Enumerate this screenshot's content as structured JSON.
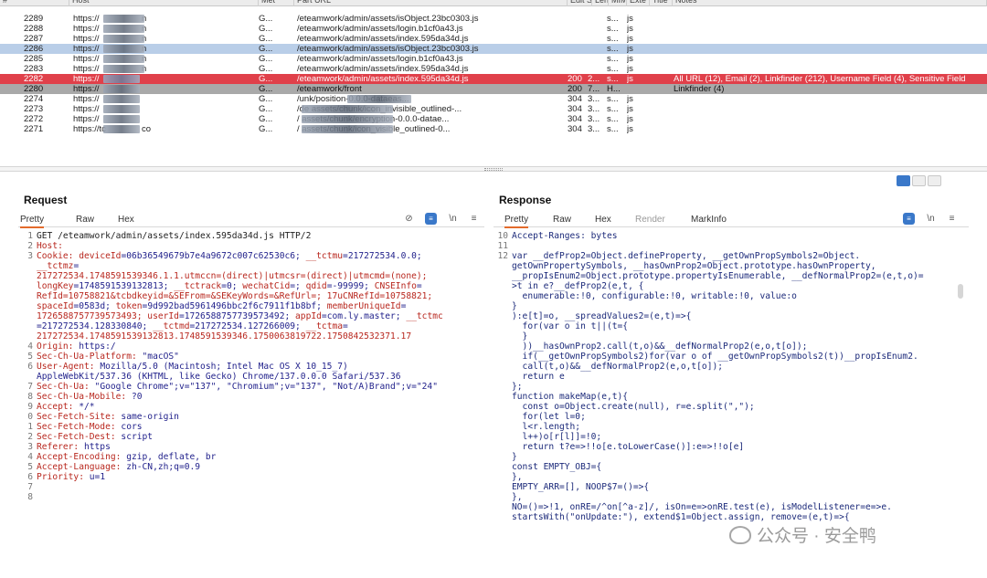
{
  "history": {
    "columns": [
      "#",
      "Host",
      "Met",
      "Part URL",
      "Edit Stat",
      "Len",
      "MIM",
      "Exte",
      "Title",
      "Notes"
    ],
    "rows": [
      {
        "num": "2289",
        "host": "https://",
        "hostend": "n",
        "method": "G...",
        "url": "/eteamwork/admin/assets/isObject.23bc0303.js",
        "status": "",
        "len": "",
        "mime": "s...",
        "ext": "js",
        "notes": "",
        "style": "normal"
      },
      {
        "num": "2288",
        "host": "https://",
        "hostend": "n",
        "method": "G...",
        "url": "/eteamwork/admin/assets/login.b1cf0a43.js",
        "status": "",
        "len": "",
        "mime": "s...",
        "ext": "js",
        "notes": "",
        "style": "normal"
      },
      {
        "num": "2287",
        "host": "https://",
        "hostend": "n",
        "method": "G...",
        "url": "/eteamwork/admin/assets/index.595da34d.js",
        "status": "",
        "len": "",
        "mime": "s...",
        "ext": "js",
        "notes": "",
        "style": "normal"
      },
      {
        "num": "2286",
        "host": "https://",
        "hostend": "n",
        "method": "G...",
        "url": "/eteamwork/admin/assets/isObject.23bc0303.js",
        "status": "",
        "len": "",
        "mime": "s...",
        "ext": "js",
        "notes": "",
        "style": "sel"
      },
      {
        "num": "2285",
        "host": "https://",
        "hostend": "n",
        "method": "G...",
        "url": "/eteamwork/admin/assets/login.b1cf0a43.js",
        "status": "",
        "len": "",
        "mime": "s...",
        "ext": "js",
        "notes": "",
        "style": "normal"
      },
      {
        "num": "2283",
        "host": "https://",
        "hostend": "n",
        "method": "G...",
        "url": "/eteamwork/admin/assets/index.595da34d.js",
        "status": "",
        "len": "",
        "mime": "s...",
        "ext": "js",
        "notes": "",
        "style": "normal"
      },
      {
        "num": "2282",
        "host": "https://",
        "hostend": "",
        "method": "G...",
        "url": "/eteamwork/admin/assets/index.595da34d.js",
        "status": "200",
        "len": "2...",
        "mime": "s...",
        "ext": "js",
        "notes": "All URL (12), Email (2), Linkfinder (212), Username Field (4), Sensitive Field",
        "style": "red"
      },
      {
        "num": "2280",
        "host": "https://",
        "hostend": "",
        "method": "G...",
        "url": "/eteamwork/front",
        "status": "200",
        "len": "7...",
        "mime": "H...",
        "ext": "",
        "notes": "Linkfinder (4)",
        "style": "grey"
      },
      {
        "num": "2274",
        "host": "https://",
        "hostend": "",
        "method": "G...",
        "url": "/unk/position-0.0.0-dataeas...",
        "status": "304",
        "len": "3...",
        "mime": "s...",
        "ext": "js",
        "notes": "",
        "style": "normal"
      },
      {
        "num": "2273",
        "host": "https://",
        "hostend": "",
        "method": "G...",
        "url": "/de                 assets/chunk/icon_invisible_outlined-...",
        "status": "304",
        "len": "3...",
        "mime": "s...",
        "ext": "js",
        "notes": "",
        "style": "normal"
      },
      {
        "num": "2272",
        "host": "https://",
        "hostend": "",
        "method": "G...",
        "url": "/               assets/chunk/encryption-0.0.0-datae...",
        "status": "304",
        "len": "3...",
        "mime": "s...",
        "ext": "js",
        "notes": "",
        "style": "normal"
      },
      {
        "num": "2271",
        "host": "https://tc",
        "hostend": "co",
        "method": "G...",
        "url": "/               assets/chunk/icon_visible_outlined-0...",
        "status": "304",
        "len": "3...",
        "mime": "s...",
        "ext": "js",
        "notes": "",
        "style": "normal"
      }
    ]
  },
  "request": {
    "title": "Request",
    "tabs": [
      "Pretty",
      "Raw",
      "Hex"
    ],
    "lines": [
      [
        {
          "t": "GET /eteamwork/admin/assets/index.595da34d.js HTTP/2",
          "c": ""
        }
      ],
      [
        {
          "t": "Host: ",
          "c": "k"
        }
      ],
      [
        {
          "t": "Cookie: ",
          "c": "k"
        },
        {
          "t": "deviceId",
          "c": "k"
        },
        {
          "t": "=06b36549679b7e4a9672c007c62530c6; ",
          "c": "v"
        },
        {
          "t": "__tctmu",
          "c": "k"
        },
        {
          "t": "=217272534.0.0;",
          "c": "v"
        }
      ],
      [
        {
          "t": "__tctmz",
          "c": "k"
        },
        {
          "t": "=",
          "c": "v"
        }
      ],
      [
        {
          "t": "217272534.1748591539346.1.1.utmccn=(direct)|utmcsr=(direct)|utmcmd=(none);",
          "c": "r"
        }
      ],
      [
        {
          "t": "longKey",
          "c": "k"
        },
        {
          "t": "=1748591539132813; ",
          "c": "v"
        },
        {
          "t": "__tctrack",
          "c": "k"
        },
        {
          "t": "=0; ",
          "c": "v"
        },
        {
          "t": "wechatCid",
          "c": "k"
        },
        {
          "t": "=; ",
          "c": "v"
        },
        {
          "t": "qdid",
          "c": "k"
        },
        {
          "t": "=-99999; ",
          "c": "v"
        },
        {
          "t": "CNSEInfo",
          "c": "k"
        },
        {
          "t": "=",
          "c": "v"
        }
      ],
      [
        {
          "t": "RefId=10758821&tcbdkeyid=&SEFrom=&SEKeyWords=&RefUrl=; 17uCNRefId=10758821;",
          "c": "r"
        }
      ],
      [
        {
          "t": "spaceId",
          "c": "k"
        },
        {
          "t": "=0583d; ",
          "c": "v"
        },
        {
          "t": "token",
          "c": "k"
        },
        {
          "t": "=9d992bad5961496bbc2f6c7911f1b8bf; ",
          "c": "v"
        },
        {
          "t": "memberUniqueId",
          "c": "k"
        },
        {
          "t": "=",
          "c": "v"
        }
      ],
      [
        {
          "t": "1726588757739573493; ",
          "c": "r"
        },
        {
          "t": "userId",
          "c": "k"
        },
        {
          "t": "=1726588757739573492; ",
          "c": "v"
        },
        {
          "t": "appId",
          "c": "k"
        },
        {
          "t": "=com.ly.master; ",
          "c": "v"
        },
        {
          "t": "__tctmc",
          "c": "k"
        }
      ],
      [
        {
          "t": "=217272534.128330840; ",
          "c": "v"
        },
        {
          "t": "__tctmd",
          "c": "k"
        },
        {
          "t": "=217272534.127266009; ",
          "c": "v"
        },
        {
          "t": "__tctma",
          "c": "k"
        },
        {
          "t": "=",
          "c": "v"
        }
      ],
      [
        {
          "t": "217272534.1748591539132813.1748591539346.1750063819722.1750842532371.17",
          "c": "r"
        }
      ],
      [
        {
          "t": "Origin: ",
          "c": "k"
        },
        {
          "t": "https:/",
          "c": "v"
        }
      ],
      [
        {
          "t": "Sec-Ch-Ua-Platform: ",
          "c": "k"
        },
        {
          "t": "\"macOS\"",
          "c": "v"
        }
      ],
      [
        {
          "t": "User-Agent: ",
          "c": "k"
        },
        {
          "t": "Mozilla/5.0 (Macintosh; Intel Mac OS X 10_15_7)",
          "c": "v"
        }
      ],
      [
        {
          "t": "AppleWebKit/537.36 (KHTML, like Gecko) Chrome/137.0.0.0 Safari/537.36",
          "c": "v"
        }
      ],
      [
        {
          "t": "Sec-Ch-Ua: ",
          "c": "k"
        },
        {
          "t": "\"Google Chrome\";v=\"137\", \"Chromium\";v=\"137\", \"Not/A)Brand\";v=\"24\"",
          "c": "v"
        }
      ],
      [
        {
          "t": "Sec-Ch-Ua-Mobile: ",
          "c": "k"
        },
        {
          "t": "?0",
          "c": "v"
        }
      ],
      [
        {
          "t": "Accept: ",
          "c": "k"
        },
        {
          "t": "*/*",
          "c": "v"
        }
      ],
      [
        {
          "t": "Sec-Fetch-Site: ",
          "c": "k"
        },
        {
          "t": "same-origin",
          "c": "v"
        }
      ],
      [
        {
          "t": "Sec-Fetch-Mode: ",
          "c": "k"
        },
        {
          "t": "cors",
          "c": "v"
        }
      ],
      [
        {
          "t": "Sec-Fetch-Dest: ",
          "c": "k"
        },
        {
          "t": "script",
          "c": "v"
        }
      ],
      [
        {
          "t": "Referer: ",
          "c": "k"
        },
        {
          "t": "https",
          "c": "v"
        }
      ],
      [
        {
          "t": "Accept-Encoding: ",
          "c": "k"
        },
        {
          "t": "gzip, deflate, br",
          "c": "v"
        }
      ],
      [
        {
          "t": "Accept-Language: ",
          "c": "k"
        },
        {
          "t": "zh-CN,zh;q=0.9",
          "c": "v"
        }
      ],
      [
        {
          "t": "Priority: ",
          "c": "k"
        },
        {
          "t": "u=1",
          "c": "v"
        }
      ],
      [
        {
          "t": "",
          "c": ""
        }
      ],
      [
        {
          "t": "",
          "c": ""
        }
      ]
    ],
    "gutter": [
      "1",
      "2",
      "3",
      "",
      "",
      "",
      "",
      "",
      "",
      "",
      "",
      "4",
      "5",
      "6",
      "",
      "7",
      "8",
      "9",
      "0",
      "1",
      "2",
      "3",
      "4",
      "5",
      "6",
      "7",
      "8"
    ]
  },
  "response": {
    "title": "Response",
    "tabs": [
      "Pretty",
      "Raw",
      "Hex",
      "Render",
      "MarkInfo"
    ],
    "gutter": [
      "10",
      "11",
      "12"
    ],
    "lines": [
      "Accept-Ranges: bytes",
      "",
      "var __defProp2=Object.defineProperty, __getOwnPropSymbols2=Object.",
      "getOwnPropertySymbols, __hasOwnProp2=Object.prototype.hasOwnProperty,",
      "__propIsEnum2=Object.prototype.propertyIsEnumerable, __defNormalProp2=(e,t,o)=",
      ">t in e?__defProp2(e,t, {",
      "  enumerable:!0, configurable:!0, writable:!0, value:o",
      "}",
      "):e[t]=o, __spreadValues2=(e,t)=>{",
      "  for(var o in t||(t={",
      "  }",
      "  ))__hasOwnProp2.call(t,o)&&__defNormalProp2(e,o,t[o]);",
      "  if(__getOwnPropSymbols2)for(var o of __getOwnPropSymbols2(t))__propIsEnum2.",
      "  call(t,o)&&__defNormalProp2(e,o,t[o]);",
      "  return e",
      "};",
      "function makeMap(e,t){",
      "  const o=Object.create(null), r=e.split(\",\");",
      "  for(let l=0;",
      "  l<r.length;",
      "  l++)o[r[l]]=!0;",
      "  return t?e=>!!o[e.toLowerCase()]:e=>!!o[e]",
      "}",
      "const EMPTY_OBJ={",
      "},",
      "EMPTY_ARR=[], NOOP$7=()=>{",
      "},",
      "NO=()=>!1, onRE=/^on[^a-z]/, isOn=e=>onRE.test(e), isModelListener=e=>e.",
      "startsWith(\"onUpdate:\"), extend$1=Object.assign, remove=(e,t)=>{"
    ]
  },
  "watermark": "公众号 · 安全鸭",
  "colors": {
    "selected_row": "#b9cee8",
    "highlight_row": "#e0404a",
    "grey_row": "#a9a9a9",
    "accent": "#e36b2b"
  }
}
